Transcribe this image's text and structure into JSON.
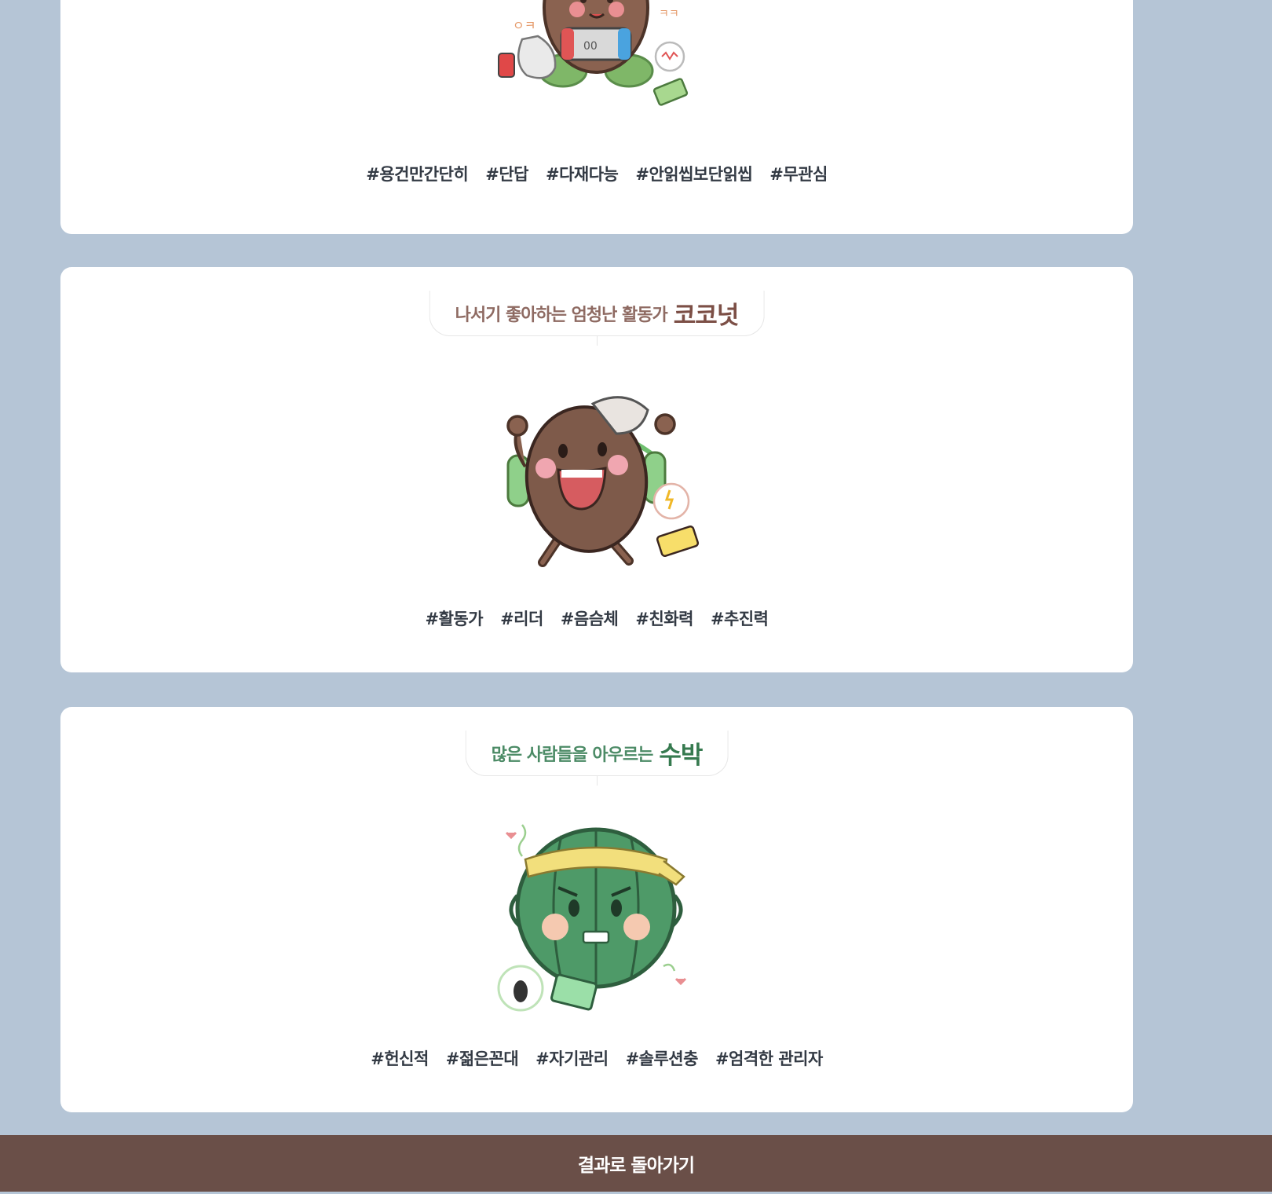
{
  "cards": [
    {
      "character": "kiwi-character",
      "tags": [
        "#용건만간단히",
        "#단답",
        "#다재다능",
        "#안읽씹보단읽씹",
        "#무관심"
      ]
    },
    {
      "subtitle": "나서기 좋아하는 엄청난 활동가",
      "name": "코코넛",
      "character": "coconut-character",
      "accent": "#7c4f46",
      "tags": [
        "#활동가",
        "#리더",
        "#음슴체",
        "#친화력",
        "#추진력"
      ]
    },
    {
      "subtitle": "많은 사람들을 아우르는",
      "name": "수박",
      "character": "watermelon-character",
      "accent": "#367a4f",
      "tags": [
        "#헌신적",
        "#젊은꼰대",
        "#자기관리",
        "#솔루션충",
        "#엄격한 관리자"
      ]
    }
  ],
  "footer": {
    "back_label": "결과로 돌아가기"
  },
  "colors": {
    "background": "#b5c5d6",
    "footer": "#6a4f48"
  }
}
